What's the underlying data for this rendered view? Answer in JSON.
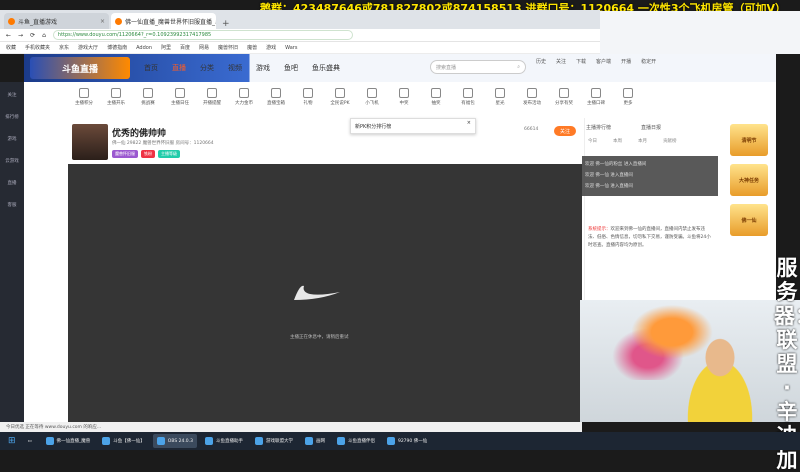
{
  "overlay_top": "鹅群：423487646或781827802或874158513   进群口号：1120664   一次性3个飞机房管（可加V）",
  "tabs": [
    {
      "label": "斗鱼_直播游戏"
    },
    {
      "label": "佛一仙直播_魔兽世界怀旧服直播_斗鱼直播"
    }
  ],
  "address": {
    "url": "https://www.douyu.com/1120664?_r=0.10923992317417985"
  },
  "bookmarks": [
    "收藏",
    "手机收藏夹",
    "京东",
    "游戏大厅",
    "博德指南",
    "Addon",
    "阿里",
    "百度",
    "网易",
    "魔兽怀旧",
    "魔兽",
    "游戏",
    "Wars"
  ],
  "nav": {
    "logo": "斗鱼直播",
    "items": [
      "首页",
      "直播",
      "分类",
      "视频",
      "游戏",
      "鱼吧",
      "鱼乐盛典"
    ],
    "active": "直播",
    "search_placeholder": "搜索直播",
    "user_icons": [
      "历史",
      "关注",
      "下载",
      "客户端",
      "开播",
      "稳定开"
    ]
  },
  "sidebar": [
    "关注",
    "排行榜",
    "游戏",
    "云游戏",
    "直播",
    "客服"
  ],
  "toolbar": [
    "主播积分",
    "主播开乐",
    "挑战赛",
    "主播日任",
    "开播提醒",
    "大力金币",
    "直播宝箱",
    "礼物",
    "全民说PK",
    "小飞机",
    "中奖",
    "抽奖",
    "有福包",
    "星光",
    "发布活动",
    "分享有奖",
    "主播口碑",
    "更多"
  ],
  "pk_panel": "新PK积分排行榜",
  "streamer": {
    "name": "优秀的佛帅帅",
    "meta": "佛一仙   29822   魔兽世界怀旧服   房间号：1120664",
    "tags": [
      "魔兽怀旧服",
      "铁粉",
      "主播等级"
    ],
    "follow": "关注",
    "follower_count": "66614"
  },
  "player": {
    "message": "主播正在休息中，请稍后重试"
  },
  "chat": {
    "tabs": [
      "主播排行榜",
      "直播日报"
    ],
    "rank_tabs": [
      "今日",
      "本周",
      "本月",
      "贡献榜"
    ],
    "overlay_lines": [
      "欢迎 佛一仙的粉丝 进入直播间",
      "欢迎 佛一仙 进入直播间",
      "欢迎 佛一仙 进入直播间"
    ],
    "notice_label": "系统提示：",
    "notice": "欢迎来到佛一仙的直播间，直播间内禁止发布违法、低俗、色情信息，切勿私下交易，谨防受骗。斗鱼将24小时巡查。直播内容均为原创。"
  },
  "ads": [
    "清明节",
    "大神任务",
    "佛一仙"
  ],
  "vertical_text": "服务器：联盟·辛迪加",
  "statusbar": "今日优选   正在等待 www.douyu.com 的响应...",
  "taskbar": [
    {
      "label": "佛一仙直播_魔兽"
    },
    {
      "label": "斗鱼【佛一仙】"
    },
    {
      "label": "OBS 24.0.3"
    },
    {
      "label": "斗鱼直播助手"
    },
    {
      "label": "游戏联盟大学"
    },
    {
      "label": "画网"
    },
    {
      "label": "斗鱼直播伴侣"
    },
    {
      "label": "92790 佛一仙"
    }
  ],
  "colors": {
    "accent": "#ff7a26",
    "brand": "#2a4fb5",
    "overlay_text": "#ffe600"
  }
}
